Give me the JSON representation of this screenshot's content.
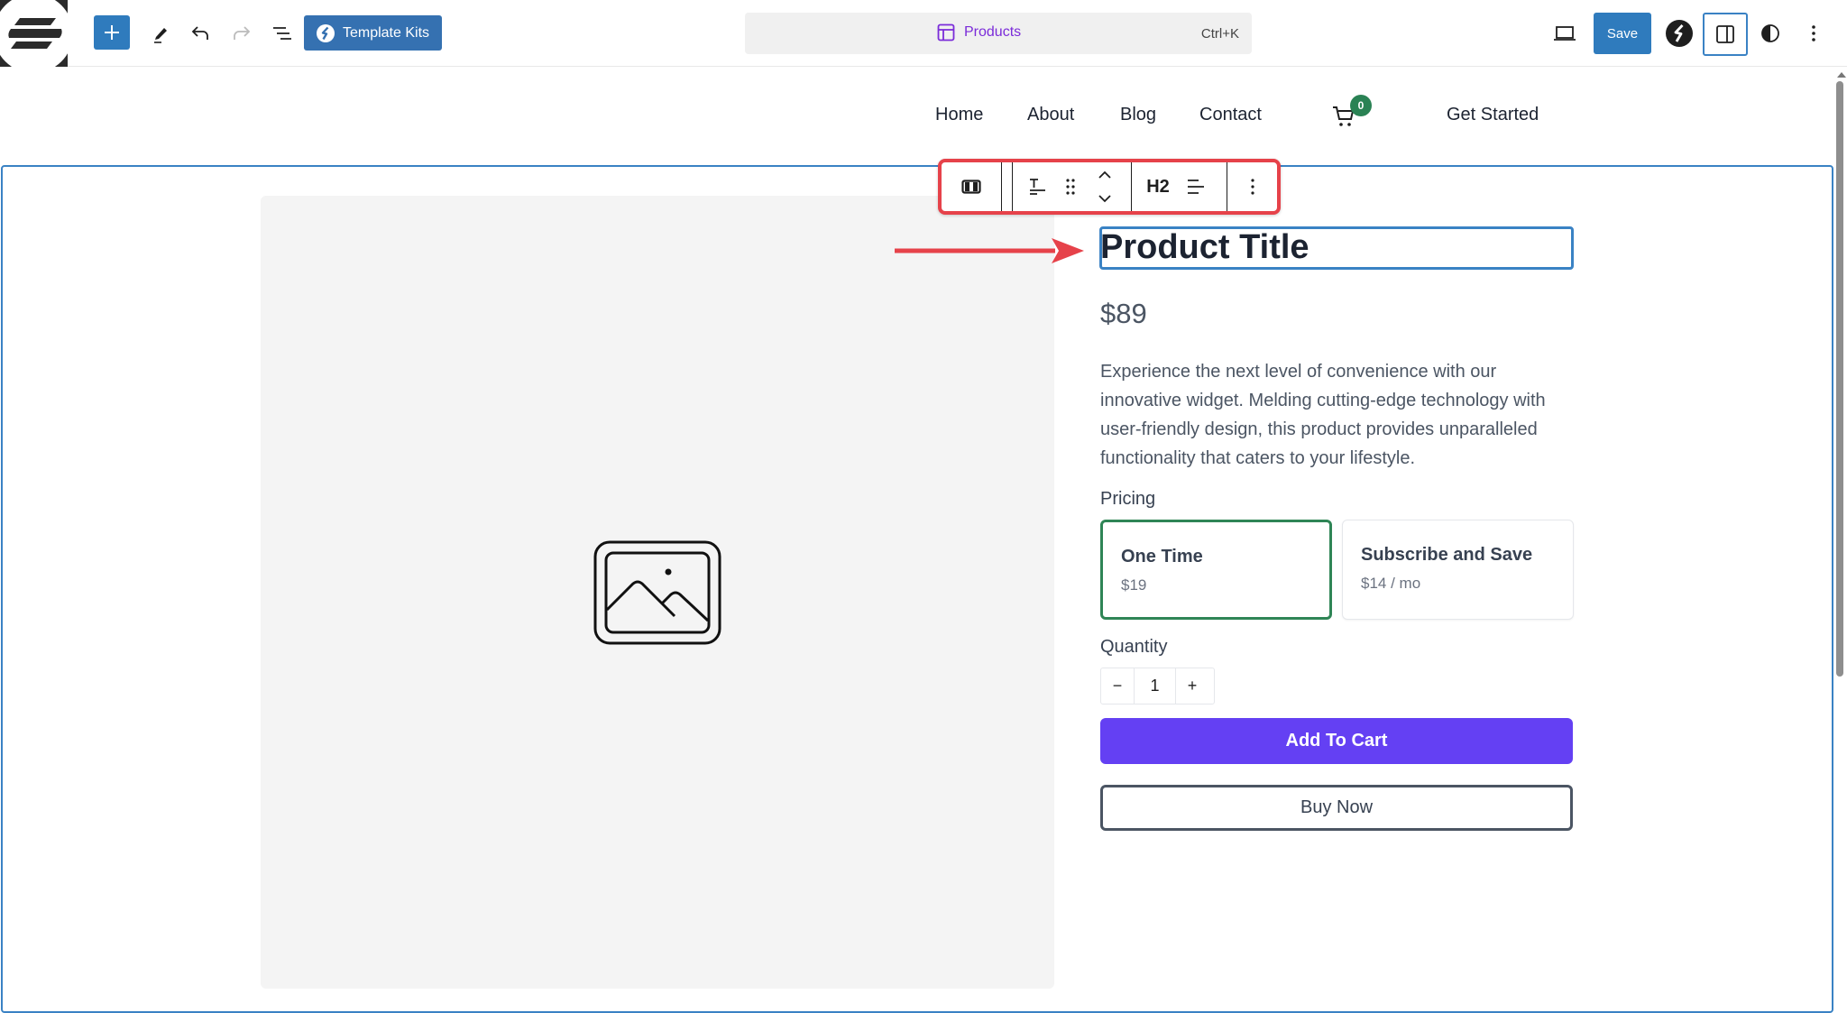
{
  "topbar": {
    "template_kits_label": "Template Kits",
    "command_palette": {
      "document_label": "Products",
      "shortcut": "Ctrl+K"
    },
    "save_label": "Save",
    "icons": [
      "site-logo-icon",
      "plus-icon",
      "pencil-icon",
      "undo-icon",
      "redo-icon",
      "document-overview-icon",
      "template-icon",
      "desktop-preview-icon",
      "brand-s-icon",
      "sidebar-toggle-icon",
      "contrast-icon",
      "more-vertical-icon"
    ]
  },
  "site_nav": {
    "links": [
      {
        "label": "Home"
      },
      {
        "label": "About"
      },
      {
        "label": "Blog"
      },
      {
        "label": "Contact"
      }
    ],
    "cart_count": "0",
    "cta_label": "Get Started"
  },
  "block_toolbar": {
    "heading_level": "H2",
    "items": [
      "block-type-icon",
      "text-style-icon",
      "drag-handle-icon",
      "move-up-icon",
      "move-down-icon",
      "heading-level",
      "align-icon",
      "more-options-icon"
    ]
  },
  "product": {
    "title": "Product Title",
    "price": "$89",
    "description": "Experience the next level of convenience with our innovative widget. Melding cutting-edge technology with user-friendly design, this product provides unparalleled functionality that caters to your lifestyle.",
    "pricing_label": "Pricing",
    "pricing_options": [
      {
        "name": "One Time",
        "price": "$19",
        "selected": true
      },
      {
        "name": "Subscribe and Save",
        "price": "$14 / mo",
        "selected": false
      }
    ],
    "quantity_label": "Quantity",
    "quantity": "1",
    "quantity_minus": "−",
    "quantity_plus": "+",
    "add_to_cart_label": "Add To Cart",
    "buy_now_label": "Buy Now"
  },
  "colors": {
    "accent_blue": "#2f7bbd",
    "selection_outline": "#3a82c4",
    "annotation_red": "#e6424a",
    "add_to_cart": "#6440f3",
    "selected_option": "#2f8556",
    "cart_badge": "#2a8254",
    "document_purple": "#7b2cd9"
  }
}
